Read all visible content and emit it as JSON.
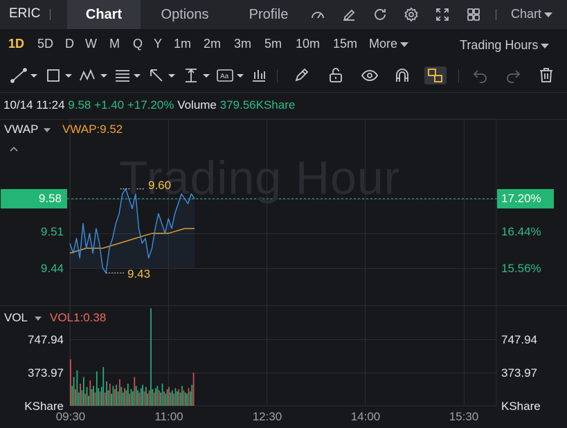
{
  "topnav": {
    "ticker": "ERIC",
    "tabs": [
      "Chart",
      "Options",
      "Profile"
    ],
    "active_tab": "Chart",
    "chart_menu": "Chart",
    "icons": [
      "speedometer-icon",
      "edit-icon",
      "refresh-icon",
      "gear-icon",
      "fullscreen-icon",
      "grid-layout-icon"
    ]
  },
  "periods": [
    "1D",
    "5D",
    "D",
    "W",
    "M",
    "Q",
    "Y",
    "1m",
    "2m",
    "3m",
    "5m",
    "10m",
    "15m",
    "More"
  ],
  "active_period": "1D",
  "trading_hours": "Trading Hours",
  "toolbar_icons": [
    "trend-line-icon",
    "rectangle-icon",
    "pattern-icon",
    "fibonacci-icon",
    "arrow-icon",
    "measure-icon",
    "text-icon",
    "bar-type-icon",
    "pencil-icon",
    "lock-icon",
    "eye-icon",
    "magnet-icon",
    "link-icon",
    "undo-icon",
    "redo-icon",
    "trash-icon"
  ],
  "quote": {
    "datetime": "10/14 11:24",
    "price": "9.58",
    "change": "+1.40",
    "change_pct": "+17.20%",
    "volume_label": "Volume",
    "volume": "379.56KShare"
  },
  "main_indicator": {
    "name": "VWAP",
    "value": "VWAP:9.52"
  },
  "vol_indicator": {
    "name": "VOL",
    "value": "VOL1:0.38"
  },
  "watermark": "Trading Hour",
  "price_axis": {
    "current": "9.58",
    "labels": [
      "9.51",
      "9.44"
    ]
  },
  "pct_axis": {
    "current": "17.20%",
    "labels": [
      "16.44%",
      "15.56%"
    ]
  },
  "vol_axis": {
    "labels": [
      "747.94",
      "373.97",
      "KShare"
    ]
  },
  "highlow": {
    "high": "9.60",
    "low": "9.43"
  },
  "time_ticks": [
    "09:30",
    "11:00",
    "12:30",
    "14:00",
    "15:30"
  ],
  "colors": {
    "up": "#2dbd85",
    "down": "#ef5350",
    "price_line": "#3d8fe0",
    "vwap_line": "#f0a32c",
    "highlight": "#f5c242"
  },
  "chart_data": {
    "type": "line",
    "title": "",
    "x_range": [
      "09:30",
      "16:00"
    ],
    "ylim": [
      9.4,
      9.63
    ],
    "series": [
      {
        "name": "",
        "x": [
          "09:30",
          "09:33",
          "09:36",
          "09:39",
          "09:42",
          "09:45",
          "09:48",
          "09:51",
          "09:54",
          "09:57",
          "10:00",
          "10:03",
          "10:06",
          "10:09",
          "10:12",
          "10:15",
          "10:18",
          "10:21",
          "10:24",
          "10:27",
          "10:30",
          "10:33",
          "10:36",
          "10:39",
          "10:42",
          "10:45",
          "10:48",
          "10:51",
          "10:54",
          "10:57",
          "11:00",
          "11:03",
          "11:06",
          "11:09",
          "11:12",
          "11:15",
          "11:18",
          "11:21",
          "11:24"
        ],
        "values": [
          9.49,
          9.47,
          9.5,
          9.46,
          9.53,
          9.48,
          9.51,
          9.47,
          9.52,
          9.49,
          9.44,
          9.43,
          9.48,
          9.5,
          9.53,
          9.55,
          9.59,
          9.6,
          9.58,
          9.56,
          9.59,
          9.52,
          9.49,
          9.5,
          9.46,
          9.48,
          9.52,
          9.55,
          9.53,
          9.51,
          9.54,
          9.52,
          9.55,
          9.57,
          9.59,
          9.58,
          9.57,
          9.59,
          9.58
        ]
      },
      {
        "name": "VWAP",
        "x": [
          "09:30",
          "09:45",
          "10:00",
          "10:15",
          "10:30",
          "10:45",
          "11:00",
          "11:15",
          "11:24"
        ],
        "values": [
          9.47,
          9.48,
          9.48,
          9.49,
          9.5,
          9.51,
          9.51,
          9.52,
          9.52
        ]
      }
    ],
    "volume": {
      "ylim": [
        0,
        900
      ],
      "values": [
        420,
        180,
        260,
        150,
        320,
        120,
        200,
        140,
        260,
        110,
        170,
        90,
        230,
        150,
        180,
        120,
        310,
        160,
        130,
        170,
        350,
        120,
        220,
        140,
        200,
        110,
        180,
        150,
        190,
        130,
        240,
        170,
        120,
        160,
        140,
        200,
        110,
        150,
        130,
        260,
        180,
        140,
        120,
        160,
        190,
        130,
        170,
        110,
        140,
        880,
        150,
        120,
        160,
        180,
        140,
        120,
        200,
        130,
        110,
        150,
        170,
        120,
        140,
        110,
        160,
        130,
        150,
        120,
        180,
        140,
        120,
        110,
        160,
        130,
        190,
        300
      ]
    }
  }
}
